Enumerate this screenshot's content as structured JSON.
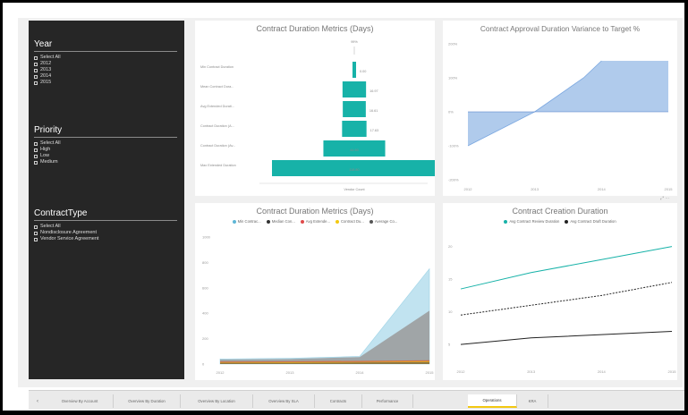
{
  "slicers": [
    {
      "title": "Year",
      "items": [
        "Select All",
        "2012",
        "2013",
        "2014",
        "2015"
      ]
    },
    {
      "title": "Priority",
      "items": [
        "Select All",
        "High",
        "Low",
        "Medium"
      ]
    },
    {
      "title": "ContractType",
      "items": [
        "Select All",
        "Nondisclosure Agreement",
        "Vendor Service Agreement"
      ]
    }
  ],
  "visuals": {
    "funnel": {
      "title": "Contract Duration Metrics (Days)",
      "top_label": "99%",
      "bottom_label": "Vendor Count",
      "chart_data": {
        "type": "bar",
        "categories": [
          "Min Contract Duration",
          "Mean Contract Dura...",
          "Avg Extended Durati...",
          "Contract Duration (A...",
          "Contract Duration (Av...",
          "Max Extended Duration"
        ],
        "values": [
          0,
          16.97,
          16.61,
          17.63,
          44.6,
          118.8
        ],
        "value_labels": [
          "0.00",
          "16.97",
          "16.61",
          "17.63",
          "44.60",
          "118.80"
        ],
        "color": "#17b2a8"
      }
    },
    "variance": {
      "title": "Contract Approval Duration Variance to Target %",
      "chart_data": {
        "type": "area",
        "x": [
          "2012",
          "2013",
          "2014",
          "2015"
        ],
        "y": [
          -100,
          0,
          100,
          150
        ],
        "y_tick_labels": [
          "200%",
          "100%",
          "0%",
          "-100%",
          "-200%"
        ],
        "ylim": [
          -200,
          200
        ],
        "color": "#a7c5ea"
      }
    },
    "area": {
      "title": "Contract Duration Metrics (Days)",
      "legend": [
        {
          "name": "Min Contrac...",
          "color": "#5eb6d6"
        },
        {
          "name": "Median Con...",
          "color": "#333333"
        },
        {
          "name": "Avg Extende...",
          "color": "#e04b4b"
        },
        {
          "name": "Contract Du...",
          "color": "#f2c811"
        },
        {
          "name": "Average Co...",
          "color": "#555555"
        }
      ],
      "chart_data": {
        "type": "area",
        "x": [
          "2012",
          "2013",
          "2014",
          "2015"
        ],
        "y_tick_labels": [
          "1000",
          "800",
          "600",
          "400",
          "200",
          "0"
        ],
        "ylim": [
          0,
          1000
        ],
        "series": [
          {
            "name": "Min Contrac...",
            "values": [
              40,
              45,
              60,
              750
            ]
          },
          {
            "name": "Median Con...",
            "values": [
              35,
              40,
              55,
              420
            ]
          },
          {
            "name": "Avg Extende...",
            "values": [
              20,
              22,
              25,
              30
            ]
          },
          {
            "name": "Contract Du...",
            "values": [
              12,
              14,
              15,
              20
            ]
          },
          {
            "name": "Average Co...",
            "values": [
              10,
              10,
              12,
              15
            ]
          }
        ]
      }
    },
    "lines": {
      "title": "Contract Creation Duration",
      "legend": [
        {
          "name": "Avg Contract Review Duration",
          "color": "#17b2a8"
        },
        {
          "name": "Avg Contract Draft Duration",
          "color": "#222222"
        }
      ],
      "chart_data": {
        "type": "line",
        "x": [
          "2012",
          "2013",
          "2014",
          "2015"
        ],
        "y_tick_labels": [
          "20",
          "15",
          "10",
          "5"
        ],
        "ylim": [
          2,
          22
        ],
        "series": [
          {
            "name": "Avg Contract Review Duration",
            "values": [
              13.5,
              16,
              18,
              20
            ]
          },
          {
            "name": "Trend",
            "values": [
              9.5,
              11,
              12.5,
              14.5
            ]
          },
          {
            "name": "Avg Contract Draft Duration",
            "values": [
              5,
              6,
              6.5,
              7
            ]
          }
        ]
      }
    }
  },
  "tabs": [
    "Overview By Account",
    "Overview By Duration",
    "Overview By Location",
    "Overview By SLA",
    "Contracts",
    "Performance",
    "Operations",
    "KRA"
  ],
  "active_tab": "Operations"
}
